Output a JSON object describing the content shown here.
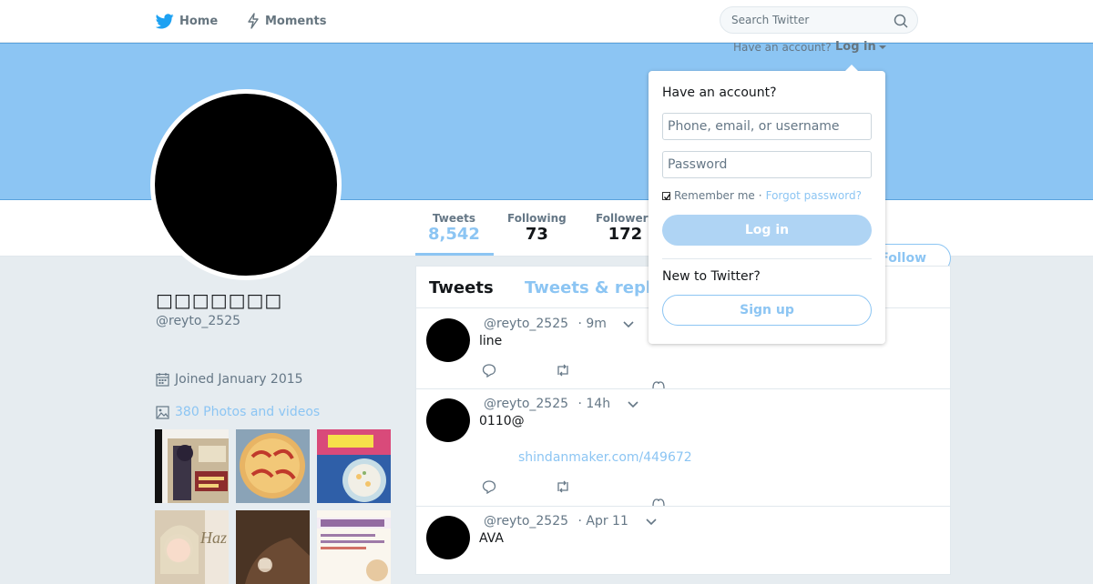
{
  "nav": {
    "home_label": "Home",
    "moments_label": "Moments",
    "search_placeholder": "Search Twitter"
  },
  "login_prompt": {
    "text": "Have an account?",
    "link": "Log in"
  },
  "profile": {
    "name": "□□□□□□□",
    "handle": "@reyto_2525",
    "joined": "Joined January 2015",
    "photos_link": "380 Photos and videos"
  },
  "stats": [
    {
      "label": "Tweets",
      "value": "8,542"
    },
    {
      "label": "Following",
      "value": "73"
    },
    {
      "label": "Followers",
      "value": "172"
    }
  ],
  "follow_label": "Follow",
  "tabs": {
    "tweets": "Tweets",
    "replies": "Tweets & replies"
  },
  "tweets": [
    {
      "handle": "@reyto_2525",
      "time": "· 9m",
      "text": "line",
      "link": ""
    },
    {
      "handle": "@reyto_2525",
      "time": "· 14h",
      "text": "0110@",
      "link": "shindanmaker.com/449672"
    },
    {
      "handle": "@reyto_2525",
      "time": "· Apr 11",
      "text": "AVA",
      "link": ""
    }
  ],
  "login_dropdown": {
    "title": "Have an account?",
    "username_placeholder": "Phone, email, or username",
    "password_placeholder": "Password",
    "remember": "Remember me",
    "separator": "·",
    "forgot": "Forgot password?",
    "login_button": "Log in",
    "new_prompt": "New to Twitter?",
    "signup_button": "Sign up"
  },
  "colors": {
    "accent": "#8cc5f3",
    "banner": "#8cc5f3",
    "background": "#e6ecf0"
  }
}
